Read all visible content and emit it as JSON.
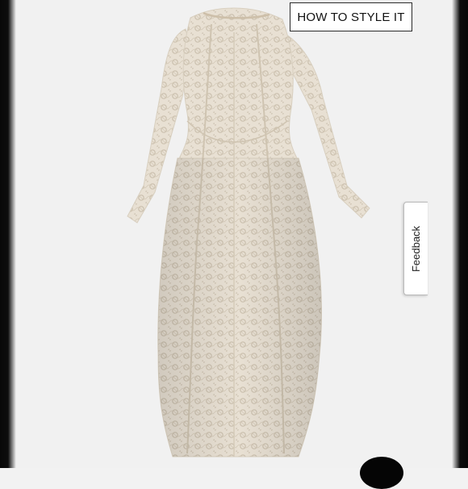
{
  "overlay": {
    "style_button_label": "HOW TO STYLE IT",
    "feedback_label": "Feedback"
  },
  "colors": {
    "frame": "#0a0a0a",
    "background": "#f1f1f1",
    "dress": "#e6ddd0",
    "lace": "#c9bda9"
  },
  "icons": {
    "product": "lace-dress-image"
  }
}
